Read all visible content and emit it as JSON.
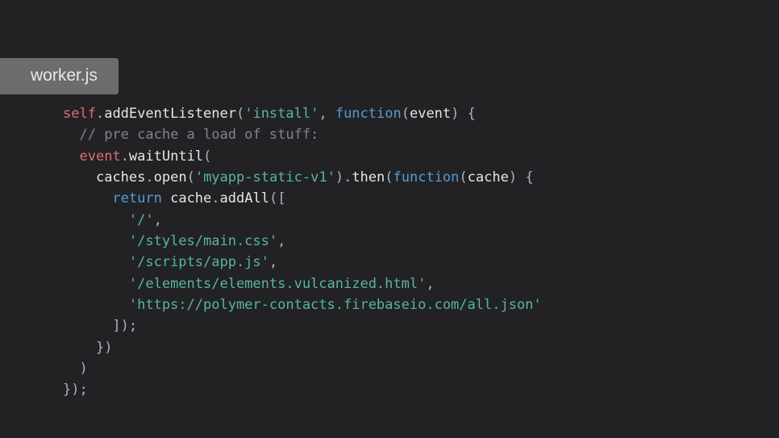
{
  "tab": {
    "filename": "worker.js"
  },
  "code": {
    "l1_self": "self",
    "l1_dot": ".",
    "l1_add": "addEventListener",
    "l1_op": "(",
    "l1_str": "'install'",
    "l1_comma": ", ",
    "l1_func": "function",
    "l1_po": "(",
    "l1_evt": "event",
    "l1_pc": ") {",
    "l2_ind": "  ",
    "l2_comment": "// pre cache a load of stuff:",
    "l3_ind": "  ",
    "l3_evt": "event",
    "l3_dot": ".",
    "l3_wait": "waitUntil",
    "l3_op": "(",
    "l4_ind": "    ",
    "l4_caches": "caches",
    "l4_dot": ".",
    "l4_open": "open",
    "l4_po": "(",
    "l4_str": "'myapp-static-v1'",
    "l4_pc": ").",
    "l4_then": "then",
    "l4_po2": "(",
    "l4_func": "function",
    "l4_po3": "(",
    "l4_cache": "cache",
    "l4_pc3": ") {",
    "l5_ind": "      ",
    "l5_ret": "return",
    "l5_sp": " ",
    "l5_cache": "cache",
    "l5_dot": ".",
    "l5_addall": "addAll",
    "l5_op": "([",
    "l6_ind": "        ",
    "l6_str": "'/'",
    "l6_c": ",",
    "l7_ind": "        ",
    "l7_str": "'/styles/main.css'",
    "l7_c": ",",
    "l8_ind": "        ",
    "l8_str": "'/scripts/app.js'",
    "l8_c": ",",
    "l9_ind": "        ",
    "l9_str": "'/elements/elements.vulcanized.html'",
    "l9_c": ",",
    "l10_ind": "        ",
    "l10_str": "'https://polymer-contacts.firebaseio.com/all.json'",
    "l11_ind": "      ",
    "l11_cl": "]);",
    "l12_ind": "    ",
    "l12_cl": "})",
    "l13_ind": "  ",
    "l13_cl": ")",
    "l14_cl": "});"
  }
}
